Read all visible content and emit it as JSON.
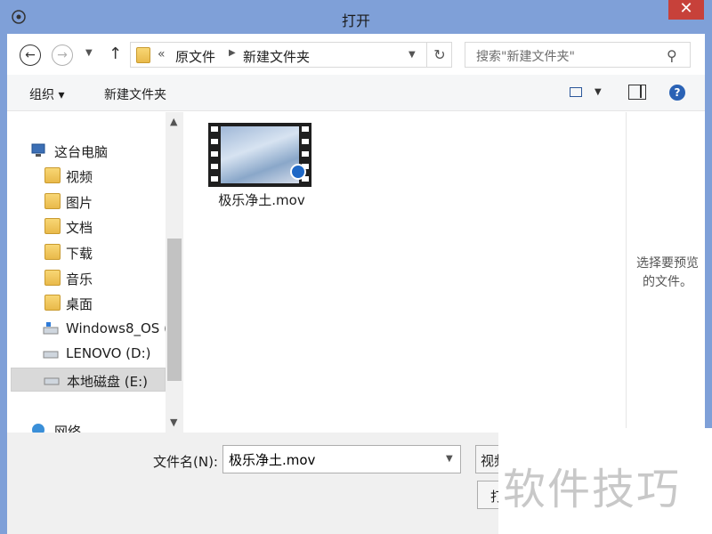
{
  "window": {
    "title": "打开",
    "close_label": "✕"
  },
  "address": {
    "overflow_chevron": "«",
    "breadcrumb": [
      "原文件",
      "新建文件夹"
    ],
    "search_placeholder": "搜索\"新建文件夹\""
  },
  "toolbar": {
    "organize_label": "组织 ▾",
    "new_folder_label": "新建文件夹"
  },
  "nav": {
    "this_pc": "这台电脑",
    "items": [
      "视频",
      "图片",
      "文档",
      "下载",
      "音乐",
      "桌面",
      "Windows8_OS (",
      "LENOVO (D:)",
      "本地磁盘 (E:)"
    ],
    "network": "网络"
  },
  "files": [
    {
      "name": "极乐净土.mov",
      "icon": "video-thumbnail-icon"
    }
  ],
  "preview": {
    "text": "选择要预览的文件。"
  },
  "bottom": {
    "filename_label": "文件名(N):",
    "filename_value": "极乐净土.mov",
    "filter_label": "视频",
    "open_label": "打"
  },
  "watermark": {
    "text": "软件技巧"
  },
  "colors": {
    "titlebar": "#7fa0d8",
    "close": "#c7413a",
    "selection": "#d9d9d9"
  }
}
